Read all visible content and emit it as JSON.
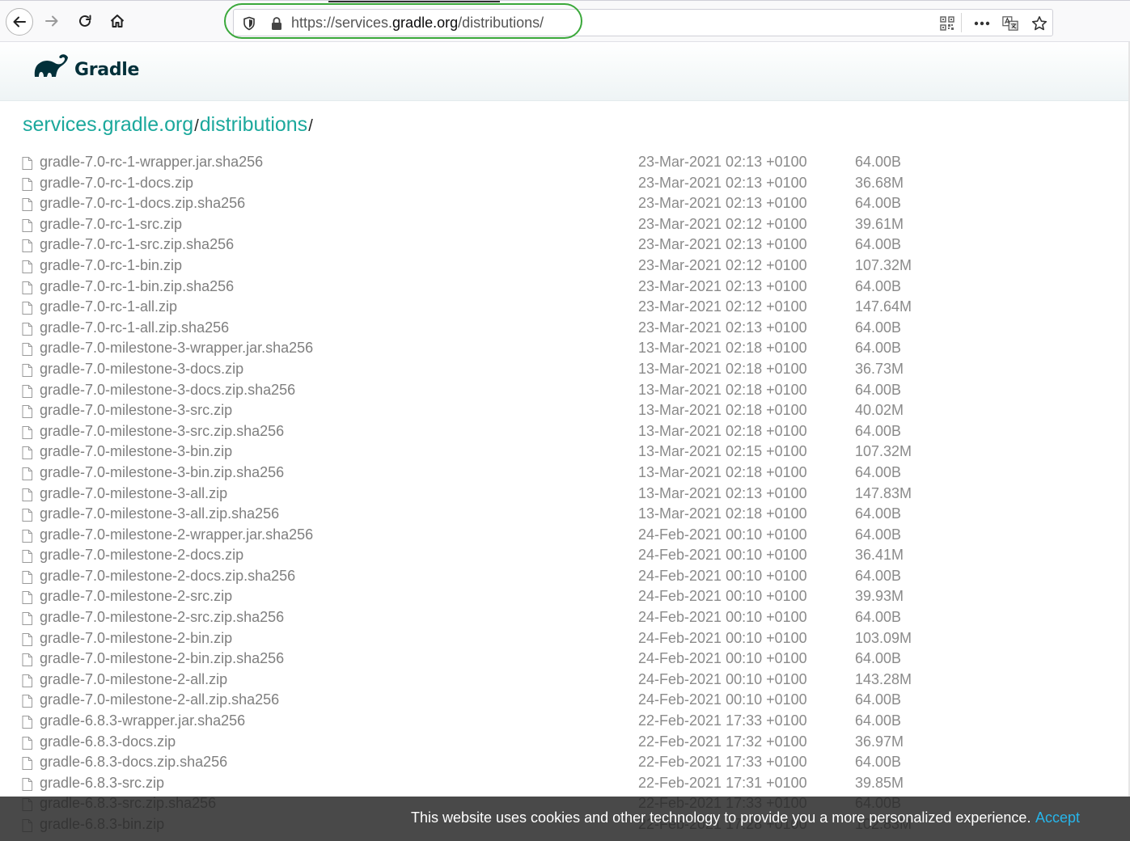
{
  "browser": {
    "url_prefix": "https://services.",
    "url_host": "gradle.org",
    "url_suffix": "/distributions/",
    "icons": [
      "back-icon",
      "forward-icon",
      "reload-icon",
      "home-icon",
      "shield-icon",
      "lock-icon",
      "qr-code-icon",
      "more-icon",
      "translate-icon",
      "bookmark-star-icon"
    ]
  },
  "site": {
    "logo_text": "Gradle"
  },
  "breadcrumb": {
    "root": "services.gradle.org",
    "sep1": "/",
    "section": "distributions",
    "sep2": "/"
  },
  "files": [
    {
      "name": "gradle-7.0-rc-1-wrapper.jar.sha256",
      "date": "23-Mar-2021 02:13 +0100",
      "size": "64.00B"
    },
    {
      "name": "gradle-7.0-rc-1-docs.zip",
      "date": "23-Mar-2021 02:13 +0100",
      "size": "36.68M"
    },
    {
      "name": "gradle-7.0-rc-1-docs.zip.sha256",
      "date": "23-Mar-2021 02:13 +0100",
      "size": "64.00B"
    },
    {
      "name": "gradle-7.0-rc-1-src.zip",
      "date": "23-Mar-2021 02:12 +0100",
      "size": "39.61M"
    },
    {
      "name": "gradle-7.0-rc-1-src.zip.sha256",
      "date": "23-Mar-2021 02:13 +0100",
      "size": "64.00B"
    },
    {
      "name": "gradle-7.0-rc-1-bin.zip",
      "date": "23-Mar-2021 02:12 +0100",
      "size": "107.32M"
    },
    {
      "name": "gradle-7.0-rc-1-bin.zip.sha256",
      "date": "23-Mar-2021 02:13 +0100",
      "size": "64.00B"
    },
    {
      "name": "gradle-7.0-rc-1-all.zip",
      "date": "23-Mar-2021 02:12 +0100",
      "size": "147.64M"
    },
    {
      "name": "gradle-7.0-rc-1-all.zip.sha256",
      "date": "23-Mar-2021 02:13 +0100",
      "size": "64.00B"
    },
    {
      "name": "gradle-7.0-milestone-3-wrapper.jar.sha256",
      "date": "13-Mar-2021 02:18 +0100",
      "size": "64.00B"
    },
    {
      "name": "gradle-7.0-milestone-3-docs.zip",
      "date": "13-Mar-2021 02:18 +0100",
      "size": "36.73M"
    },
    {
      "name": "gradle-7.0-milestone-3-docs.zip.sha256",
      "date": "13-Mar-2021 02:18 +0100",
      "size": "64.00B"
    },
    {
      "name": "gradle-7.0-milestone-3-src.zip",
      "date": "13-Mar-2021 02:18 +0100",
      "size": "40.02M"
    },
    {
      "name": "gradle-7.0-milestone-3-src.zip.sha256",
      "date": "13-Mar-2021 02:18 +0100",
      "size": "64.00B"
    },
    {
      "name": "gradle-7.0-milestone-3-bin.zip",
      "date": "13-Mar-2021 02:15 +0100",
      "size": "107.32M"
    },
    {
      "name": "gradle-7.0-milestone-3-bin.zip.sha256",
      "date": "13-Mar-2021 02:18 +0100",
      "size": "64.00B"
    },
    {
      "name": "gradle-7.0-milestone-3-all.zip",
      "date": "13-Mar-2021 02:13 +0100",
      "size": "147.83M"
    },
    {
      "name": "gradle-7.0-milestone-3-all.zip.sha256",
      "date": "13-Mar-2021 02:18 +0100",
      "size": "64.00B"
    },
    {
      "name": "gradle-7.0-milestone-2-wrapper.jar.sha256",
      "date": "24-Feb-2021 00:10 +0100",
      "size": "64.00B"
    },
    {
      "name": "gradle-7.0-milestone-2-docs.zip",
      "date": "24-Feb-2021 00:10 +0100",
      "size": "36.41M"
    },
    {
      "name": "gradle-7.0-milestone-2-docs.zip.sha256",
      "date": "24-Feb-2021 00:10 +0100",
      "size": "64.00B"
    },
    {
      "name": "gradle-7.0-milestone-2-src.zip",
      "date": "24-Feb-2021 00:10 +0100",
      "size": "39.93M"
    },
    {
      "name": "gradle-7.0-milestone-2-src.zip.sha256",
      "date": "24-Feb-2021 00:10 +0100",
      "size": "64.00B"
    },
    {
      "name": "gradle-7.0-milestone-2-bin.zip",
      "date": "24-Feb-2021 00:10 +0100",
      "size": "103.09M"
    },
    {
      "name": "gradle-7.0-milestone-2-bin.zip.sha256",
      "date": "24-Feb-2021 00:10 +0100",
      "size": "64.00B"
    },
    {
      "name": "gradle-7.0-milestone-2-all.zip",
      "date": "24-Feb-2021 00:10 +0100",
      "size": "143.28M"
    },
    {
      "name": "gradle-7.0-milestone-2-all.zip.sha256",
      "date": "24-Feb-2021 00:10 +0100",
      "size": "64.00B"
    },
    {
      "name": "gradle-6.8.3-wrapper.jar.sha256",
      "date": "22-Feb-2021 17:33 +0100",
      "size": "64.00B"
    },
    {
      "name": "gradle-6.8.3-docs.zip",
      "date": "22-Feb-2021 17:32 +0100",
      "size": "36.97M"
    },
    {
      "name": "gradle-6.8.3-docs.zip.sha256",
      "date": "22-Feb-2021 17:33 +0100",
      "size": "64.00B"
    },
    {
      "name": "gradle-6.8.3-src.zip",
      "date": "22-Feb-2021 17:31 +0100",
      "size": "39.85M"
    },
    {
      "name": "gradle-6.8.3-src.zip.sha256",
      "date": "22-Feb-2021 17:33 +0100",
      "size": "64.00B"
    },
    {
      "name": "gradle-6.8.3-bin.zip",
      "date": "22-Feb-2021 17:28 +0100",
      "size": "102.83M"
    }
  ],
  "cookie": {
    "message": "This website uses cookies and other technology to provide you a more personalized experience.",
    "accept": "Accept"
  }
}
